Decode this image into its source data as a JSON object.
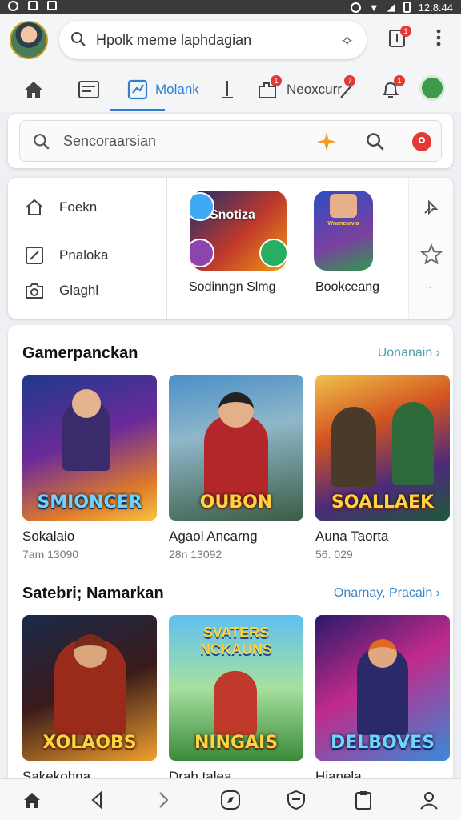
{
  "status_bar": {
    "time": "12:8:44"
  },
  "top_bar": {
    "search_text": "Hpolk meme laphdagian",
    "notification_count": "1"
  },
  "tabs": [
    {
      "label": ""
    },
    {
      "label": ""
    },
    {
      "label": "Molank"
    },
    {
      "label": ""
    },
    {
      "label": "Neoxcurr",
      "badge": "1"
    },
    {
      "label": "",
      "badge": "7"
    },
    {
      "label": "",
      "badge": "1"
    }
  ],
  "secondary_search": {
    "placeholder": "Sencoraarsian"
  },
  "quick_panel": {
    "items": [
      {
        "label": "Foekn",
        "icon": "home-outline-icon"
      },
      {
        "label": "Pnaloka",
        "icon": "edit-icon"
      },
      {
        "label": "Glaghl",
        "icon": "camera-icon"
      }
    ],
    "tiles": [
      {
        "label": "Sodinngn Slmg",
        "art_text": "Snotiza"
      },
      {
        "label": "Bookceang",
        "art_text": "Wnancarvia"
      }
    ]
  },
  "sections": [
    {
      "title": "Gamerpanckan",
      "link": "Uonanain",
      "cards": [
        {
          "title": "Sokalaio",
          "subtitle": "7am 13090",
          "logo": "SMIONCER"
        },
        {
          "title": "Agaol Ancarng",
          "subtitle": "28n 13092",
          "logo": "OUBON"
        },
        {
          "title": "Auna Taorta",
          "subtitle": "56. 029",
          "logo": "SOALLAEK"
        }
      ]
    },
    {
      "title": "Satebri; Namarkan",
      "link": "Onarnay, Pracain",
      "cards": [
        {
          "title": "Sakekohna",
          "logo": "XOLAOBS"
        },
        {
          "title": "Drah talea",
          "logo": "NINGAIS"
        },
        {
          "title": "Hianela",
          "logo": "DELBOVES"
        }
      ]
    }
  ]
}
